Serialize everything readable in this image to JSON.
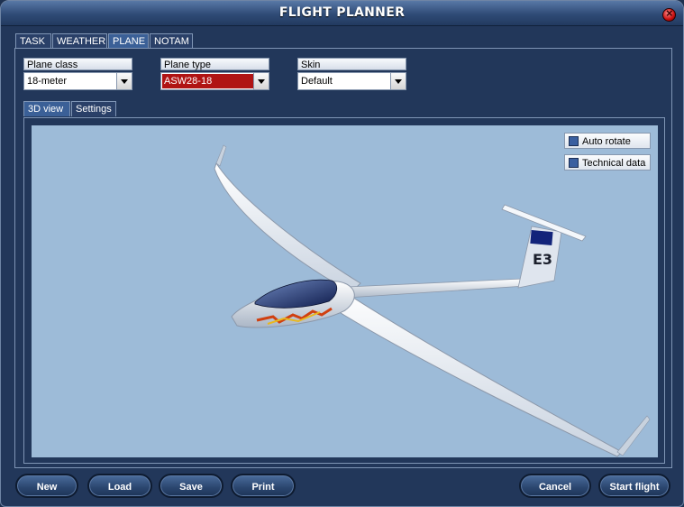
{
  "window": {
    "title": "FLIGHT PLANNER"
  },
  "tabs": [
    {
      "label": "TASK",
      "active": false
    },
    {
      "label": "WEATHER",
      "active": false
    },
    {
      "label": "PLANE",
      "active": true
    },
    {
      "label": "NOTAM",
      "active": false
    }
  ],
  "plane_class": {
    "label": "Plane class",
    "value": "18-meter"
  },
  "plane_type": {
    "label": "Plane type",
    "value": "ASW28-18"
  },
  "skin": {
    "label": "Skin",
    "value": "Default"
  },
  "subtabs": [
    {
      "label": "3D view",
      "active": true
    },
    {
      "label": "Settings",
      "active": false
    }
  ],
  "view": {
    "auto_rotate": {
      "label": "Auto rotate",
      "checked": false
    },
    "technical_data": {
      "label": "Technical data",
      "checked": false
    },
    "tail_code": "E3",
    "sky_color": "#9dbbd8"
  },
  "buttons": {
    "new": "New",
    "load": "Load",
    "save": "Save",
    "print": "Print",
    "cancel": "Cancel",
    "start_flight": "Start flight"
  },
  "colors": {
    "window_bg": "#22375a",
    "titlebar": "#3b5a87",
    "highlight_red": "#b01414",
    "close_button": "#c80e0e"
  }
}
